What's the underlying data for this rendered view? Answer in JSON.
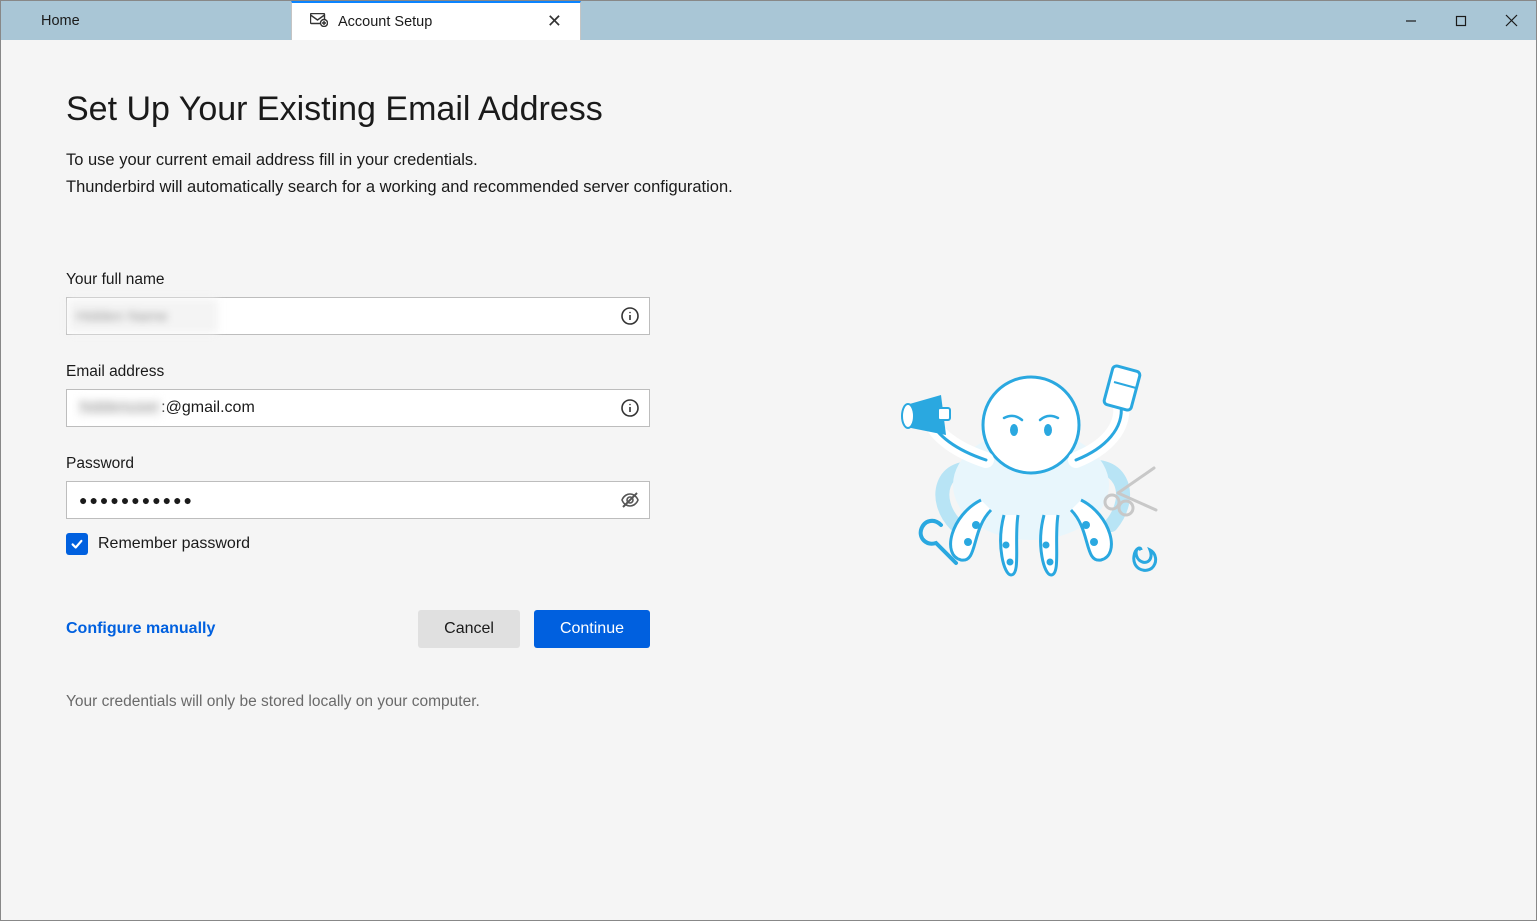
{
  "tabs": {
    "home": "Home",
    "active": "Account Setup"
  },
  "header": {
    "title": "Set Up Your Existing Email Address",
    "subtitle_line1": "To use your current email address fill in your credentials.",
    "subtitle_line2": "Thunderbird will automatically search for a working and recommended server configuration."
  },
  "form": {
    "name_label": "Your full name",
    "name_value": "Hidden Name",
    "email_label": "Email address",
    "email_blurred": "hiddenuser",
    "email_suffix": ":@gmail.com",
    "password_label": "Password",
    "password_value": "●●●●●●●●●●●",
    "remember_label": "Remember password",
    "remember_checked": true
  },
  "buttons": {
    "configure": "Configure manually",
    "cancel": "Cancel",
    "continue": "Continue"
  },
  "footer": {
    "note": "Your credentials will only be stored locally on your computer."
  }
}
